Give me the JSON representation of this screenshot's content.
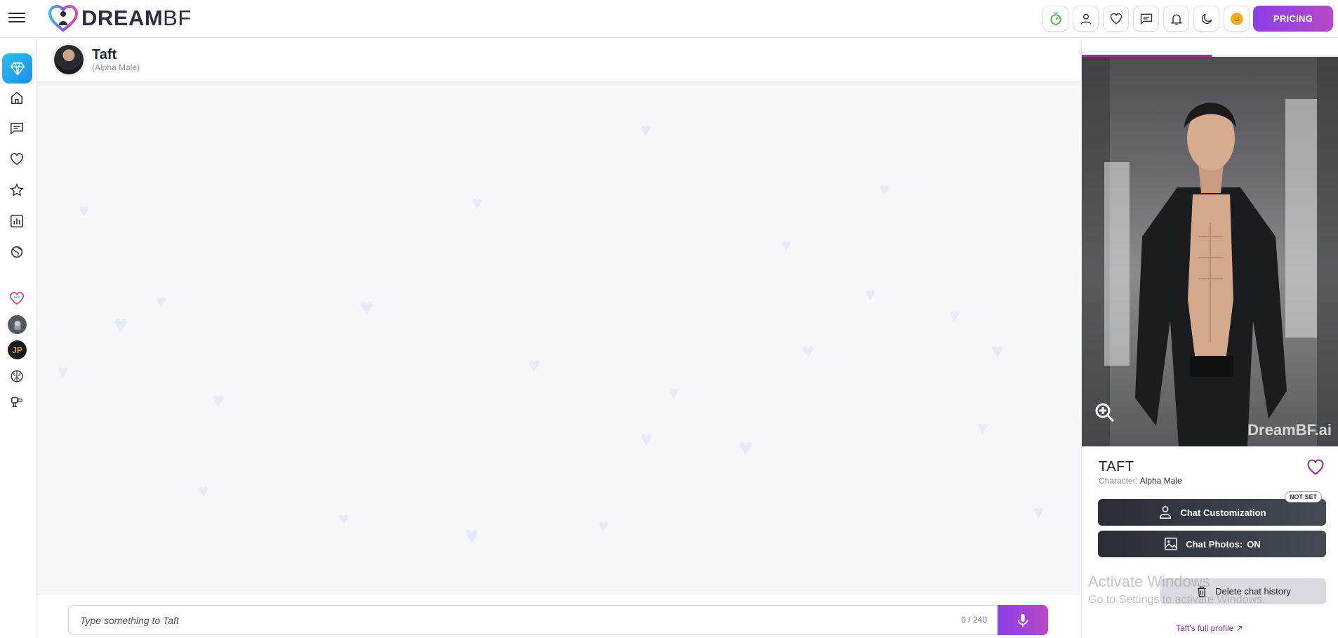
{
  "app": {
    "logo_text_bold": "DREAM",
    "logo_text_light": "BF"
  },
  "topbar": {
    "icons": [
      "coin-timer-icon",
      "user-icon",
      "heart-icon",
      "chat-icon",
      "bell-icon",
      "moon-icon",
      "smiley-coin-icon"
    ],
    "pricing_label": "PRICING"
  },
  "sidebar": {
    "items": [
      "diamond-icon",
      "home-icon",
      "chat-icon",
      "heart-icon",
      "star-icon",
      "stats-icon",
      "globe-icon",
      "chat-heart-icon",
      "helmet-avatar-icon",
      "jp-avatar",
      "brain-icon",
      "robot-icon"
    ],
    "jp_badge": "JP"
  },
  "chat": {
    "name": "Taft",
    "subtitle": "(Alpha Male)",
    "input_placeholder": "Type something to Taft",
    "char_count": "0 / 240"
  },
  "profile": {
    "name": "TAFT",
    "character_label": "Character:",
    "character_value": "Alpha Male",
    "watermark": "DreamBF.ai",
    "chat_customization_label": "Chat Customization",
    "not_set_badge": "NOT SET",
    "chat_photos_label": "Chat Photos:",
    "chat_photos_value": "ON",
    "delete_label": "Delete chat history",
    "full_profile_label": "Taft's full profile ↗"
  },
  "os_overlay": {
    "title": "Activate Windows",
    "subtitle": "Go to Settings to activate Windows."
  },
  "colors": {
    "accent": "#8d3fe6",
    "accent2": "#b549c9",
    "profile_link": "#8a3a8f"
  }
}
